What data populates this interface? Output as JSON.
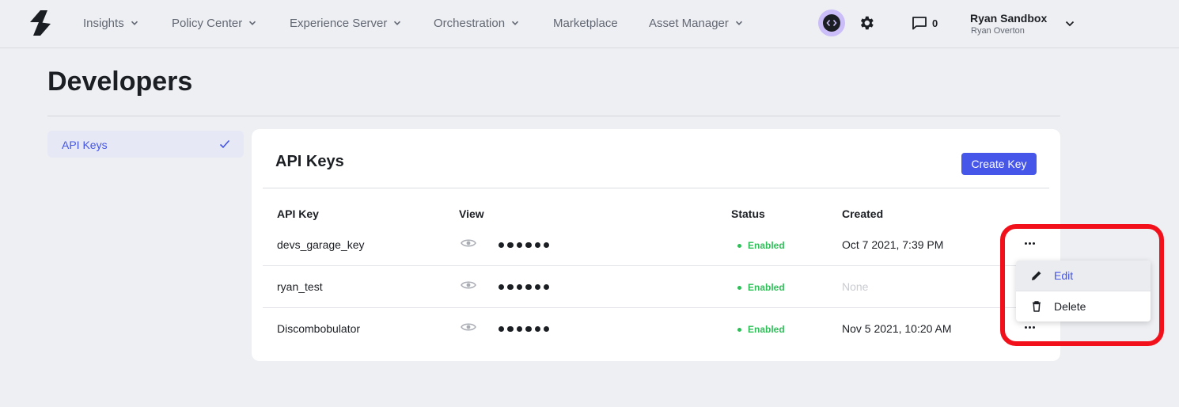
{
  "nav": {
    "items": [
      {
        "label": "Insights",
        "has_menu": true
      },
      {
        "label": "Policy Center",
        "has_menu": true
      },
      {
        "label": "Experience Server",
        "has_menu": true
      },
      {
        "label": "Orchestration",
        "has_menu": true
      },
      {
        "label": "Marketplace",
        "has_menu": false
      },
      {
        "label": "Asset Manager",
        "has_menu": true
      }
    ],
    "icons": [
      "logo-icon",
      "developer-code-icon",
      "gear-icon",
      "message-icon",
      "chevron-down-icon"
    ],
    "messages_count": "0",
    "user_name": "Ryan Sandbox",
    "user_subtitle": "Ryan Overton"
  },
  "page": {
    "title": "Developers"
  },
  "sidebar": {
    "items": [
      {
        "label": "API Keys",
        "selected": true
      }
    ]
  },
  "card": {
    "title": "API Keys",
    "create_label": "Create Key",
    "columns": [
      "API Key",
      "View",
      "Status",
      "Created"
    ],
    "rows": [
      {
        "name": "devs_garage_key",
        "status": "Enabled",
        "created": "Oct 7 2021, 7:39 PM",
        "created_muted": false
      },
      {
        "name": "ryan_test",
        "status": "Enabled",
        "created": "None",
        "created_muted": true
      },
      {
        "name": "Discombobulator",
        "status": "Enabled",
        "created": "Nov 5 2021, 10:20 AM",
        "created_muted": false
      }
    ]
  },
  "menu": {
    "items": [
      {
        "label": "Edit",
        "icon": "pencil-icon",
        "highlighted": true
      },
      {
        "label": "Delete",
        "icon": "trash-icon",
        "highlighted": false
      }
    ]
  },
  "colors": {
    "accent": "#4656e9",
    "status_enabled": "#2fbf58",
    "highlight_box": "#f2101a",
    "developer_badge": "#cbbdf7"
  }
}
